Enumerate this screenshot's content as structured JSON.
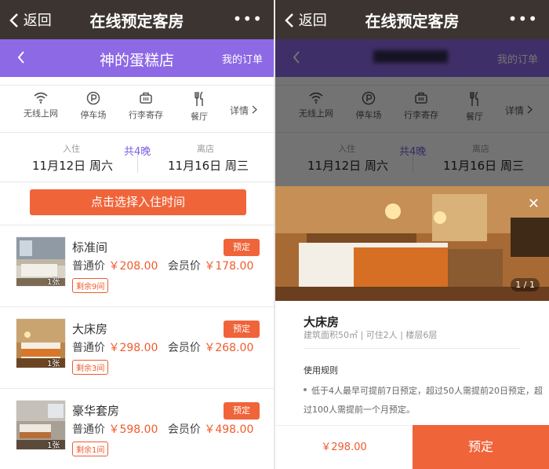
{
  "topbar": {
    "back_label": "返回",
    "title": "在线预定客房",
    "more": "•••"
  },
  "shop": {
    "name": "神的蛋糕店",
    "orders_label": "我的订单"
  },
  "amenities": [
    {
      "label": "无线上网",
      "icon": "wifi-icon"
    },
    {
      "label": "停车场",
      "icon": "parking-icon"
    },
    {
      "label": "行李寄存",
      "icon": "luggage-icon"
    },
    {
      "label": "餐厅",
      "icon": "restaurant-icon"
    }
  ],
  "detail_label": "详情",
  "stay": {
    "checkin_label": "入住",
    "checkin_date": "11月12日 周六",
    "nights": "共4晚",
    "checkout_label": "离店",
    "checkout_date": "11月16日 周三"
  },
  "cta_label": "点击选择入住时间",
  "rooms": [
    {
      "name": "标准间",
      "count": "1张",
      "normal_label": "普通价",
      "normal_price": "￥208.00",
      "member_label": "会员价",
      "member_price": "￥178.00",
      "remain": "剩余9间",
      "book": "预定"
    },
    {
      "name": "大床房",
      "count": "1张",
      "normal_label": "普通价",
      "normal_price": "￥298.00",
      "member_label": "会员价",
      "member_price": "￥268.00",
      "remain": "剩余3间",
      "book": "预定"
    },
    {
      "name": "豪华套房",
      "count": "1张",
      "normal_label": "普通价",
      "normal_price": "￥598.00",
      "member_label": "会员价",
      "member_price": "￥498.00",
      "remain": "剩余1间",
      "book": "预定"
    }
  ],
  "room_detail": {
    "page_indicator": "1 / 1",
    "name": "大床房",
    "info": "建筑面积50㎡ | 可住2人 | 楼层6层",
    "rules_title": "使用规则",
    "rules_text": "低于4人最早可提前7日预定，超过50人需提前20日预定，超过100人需提前一个月预定。",
    "price": "￥298.00",
    "book": "预定"
  },
  "colors": {
    "accent": "#f0643a",
    "purple": "#8d69e6",
    "topbar": "#3c3430"
  }
}
